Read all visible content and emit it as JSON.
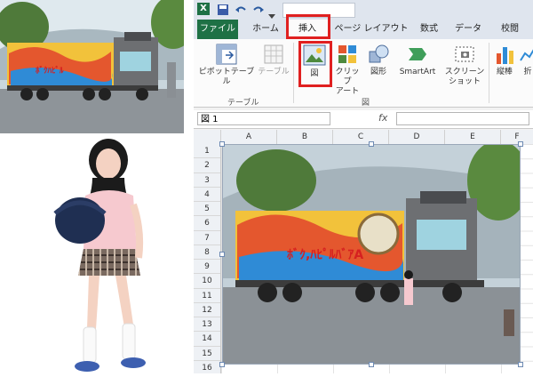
{
  "title_bar": {
    "app_badge": "X"
  },
  "tabs": [
    {
      "label": "ファイル"
    },
    {
      "label": "ホーム"
    },
    {
      "label": "挿入"
    },
    {
      "label": "ページ レイアウト"
    },
    {
      "label": "数式"
    },
    {
      "label": "データ"
    },
    {
      "label": "校閲"
    }
  ],
  "ribbon": {
    "pivot_table": "ピボットテーブル",
    "table": "テーブル",
    "group_tables": "テーブル",
    "picture": "図",
    "clip_art": "クリップ\nアート",
    "shapes": "図形",
    "smartart": "SmartArt",
    "screenshot": "スクリーン\nショット",
    "group_illustrations": "図",
    "vertical_chart": "縦棒",
    "line_chart": "折"
  },
  "formula_bar": {
    "name_box": "図 1",
    "fx": "fx"
  },
  "columns": [
    "A",
    "B",
    "C",
    "D",
    "E",
    "F"
  ],
  "rows": [
    "1",
    "2",
    "3",
    "4",
    "5",
    "6",
    "7",
    "8",
    "9",
    "10",
    "11",
    "12",
    "13",
    "14",
    "15",
    "16"
  ],
  "truck_art_text": "ﾎﾞｸ,ﾊﾋﾟﾙﾊﾞｱA",
  "colors": {
    "file_tab": "#1e7145",
    "highlight": "#e02020",
    "ribbon_bg": "#fbfbfb"
  }
}
